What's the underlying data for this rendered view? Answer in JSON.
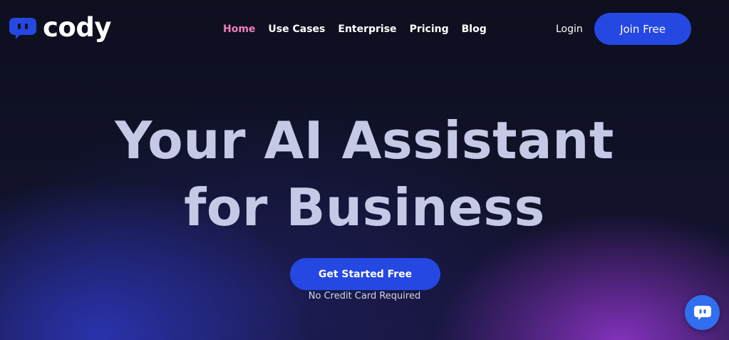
{
  "brand": {
    "name": "cody",
    "icon": "chat-bot-icon",
    "accent_color": "#2547e2"
  },
  "nav": {
    "items": [
      {
        "label": "Home",
        "active": true
      },
      {
        "label": "Use Cases",
        "active": false
      },
      {
        "label": "Enterprise",
        "active": false
      },
      {
        "label": "Pricing",
        "active": false
      },
      {
        "label": "Blog",
        "active": false
      }
    ],
    "active_color": "#f07fbd"
  },
  "header": {
    "login_label": "Login",
    "join_label": "Join Free"
  },
  "hero": {
    "title_line1": "Your AI Assistant",
    "title_line2": "for Business",
    "cta_label": "Get Started Free",
    "cta_note": "No Credit Card Required"
  },
  "chat_widget": {
    "icon": "chat-bot-icon",
    "color": "#2f6ff0"
  }
}
